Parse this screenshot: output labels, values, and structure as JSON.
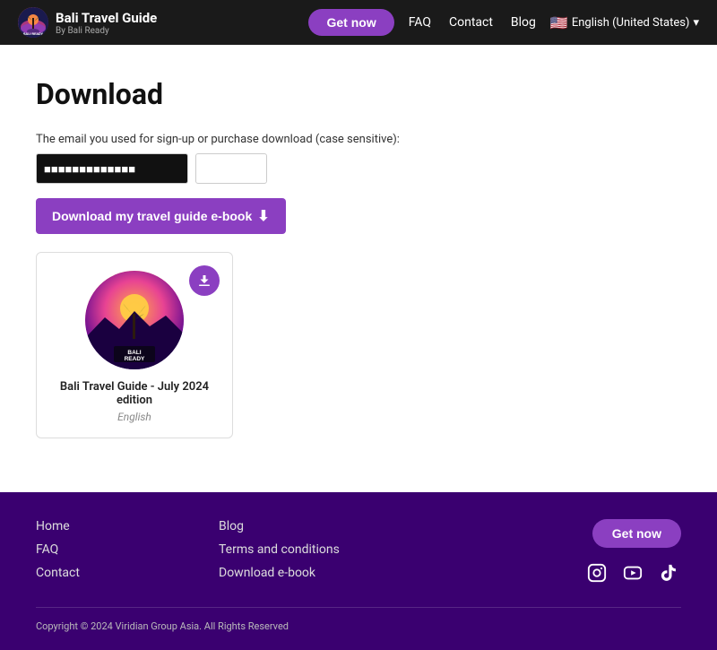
{
  "header": {
    "logo_title": "Bali Travel Guide",
    "logo_sub": "By Bali Ready",
    "get_now_label": "Get now",
    "nav": [
      {
        "label": "FAQ",
        "href": "#"
      },
      {
        "label": "Contact",
        "href": "#"
      },
      {
        "label": "Blog",
        "href": "#"
      }
    ],
    "lang_label": "🇺🇸 English (United States)",
    "lang_chevron": "▾"
  },
  "main": {
    "page_title": "Download",
    "email_label": "The email you used for sign-up or purchase download (case sensitive):",
    "email_placeholder": "",
    "download_btn_label": "Download my travel guide e-book",
    "book": {
      "title": "Bali Travel Guide - July 2024 edition",
      "language": "English",
      "badge_line1": "BALI",
      "badge_line2": "READY"
    }
  },
  "footer": {
    "col1": [
      {
        "label": "Home",
        "href": "#"
      },
      {
        "label": "FAQ",
        "href": "#"
      },
      {
        "label": "Contact",
        "href": "#"
      }
    ],
    "col2": [
      {
        "label": "Blog",
        "href": "#"
      },
      {
        "label": "Terms and conditions",
        "href": "#"
      },
      {
        "label": "Download e-book",
        "href": "#"
      }
    ],
    "get_now_label": "Get now",
    "social": [
      {
        "name": "instagram",
        "glyph": "⬜"
      },
      {
        "name": "youtube",
        "glyph": "⬜"
      },
      {
        "name": "tiktok",
        "glyph": "⬜"
      }
    ],
    "copyright": "Copyright © 2024 Viridian Group Asia. All Rights Reserved"
  }
}
